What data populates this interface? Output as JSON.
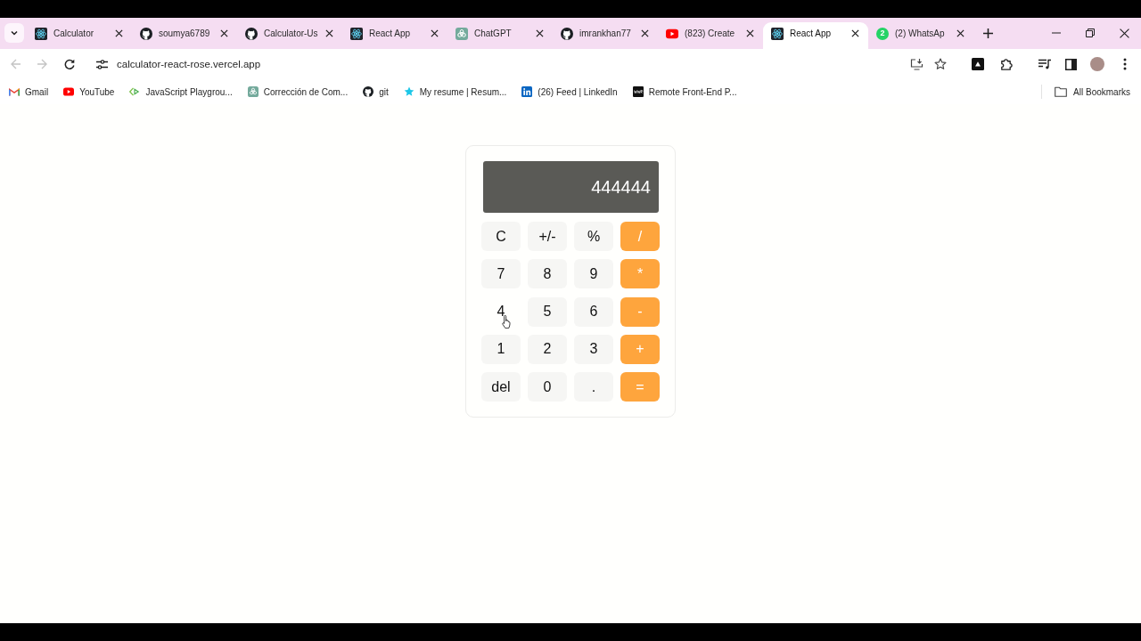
{
  "tabs_bar": {
    "tabs": [
      {
        "title": "Calculator",
        "kind": "react",
        "selected": false
      },
      {
        "title": "soumya6789",
        "kind": "github",
        "selected": false
      },
      {
        "title": "Calculator-Us",
        "kind": "github",
        "selected": false
      },
      {
        "title": "React App",
        "kind": "react",
        "selected": false
      },
      {
        "title": "ChatGPT",
        "kind": "chatgpt",
        "selected": false
      },
      {
        "title": "imrankhan77",
        "kind": "github",
        "selected": false
      },
      {
        "title": "(823) Create",
        "kind": "youtube",
        "selected": false
      },
      {
        "title": "React App",
        "kind": "react",
        "selected": true
      },
      {
        "title": "(2) WhatsAp",
        "kind": "whatsapp",
        "badge": "2",
        "selected": false
      }
    ]
  },
  "toolbar": {
    "back": {
      "disabled": true
    },
    "forward": {
      "disabled": true
    },
    "url": "calculator-react-rose.vercel.app"
  },
  "bookmarks_bar": {
    "items": [
      {
        "label": "Gmail",
        "kind": "gmail"
      },
      {
        "label": "YouTube",
        "kind": "youtube"
      },
      {
        "label": "JavaScript Playgrou...",
        "kind": "playground"
      },
      {
        "label": "Corrección de Com...",
        "kind": "chatgpt"
      },
      {
        "label": "git",
        "kind": "github"
      },
      {
        "label": "My resume | Resum...",
        "kind": "star"
      },
      {
        "label": "(26) Feed | LinkedIn",
        "kind": "linkedin"
      },
      {
        "label": "Remote Front-End P...",
        "kind": "wwr"
      }
    ],
    "all_bookmarks": "All Bookmarks"
  },
  "calculator": {
    "display": "444444",
    "keys": [
      {
        "label": "C",
        "kind": "function",
        "hovered": false
      },
      {
        "label": "+/-",
        "kind": "function",
        "hovered": false
      },
      {
        "label": "%",
        "kind": "function",
        "hovered": false
      },
      {
        "label": "/",
        "kind": "operator",
        "hovered": false
      },
      {
        "label": "7",
        "kind": "digit",
        "hovered": false
      },
      {
        "label": "8",
        "kind": "digit",
        "hovered": false
      },
      {
        "label": "9",
        "kind": "digit",
        "hovered": false
      },
      {
        "label": "*",
        "kind": "operator",
        "hovered": false
      },
      {
        "label": "4",
        "kind": "digit",
        "hovered": true
      },
      {
        "label": "5",
        "kind": "digit",
        "hovered": false
      },
      {
        "label": "6",
        "kind": "digit",
        "hovered": false
      },
      {
        "label": "-",
        "kind": "operator",
        "hovered": false
      },
      {
        "label": "1",
        "kind": "digit",
        "hovered": false
      },
      {
        "label": "2",
        "kind": "digit",
        "hovered": false
      },
      {
        "label": "3",
        "kind": "digit",
        "hovered": false
      },
      {
        "label": "+",
        "kind": "operator",
        "hovered": false
      },
      {
        "label": "del",
        "kind": "function",
        "hovered": false
      },
      {
        "label": "0",
        "kind": "digit",
        "hovered": false
      },
      {
        "label": ".",
        "kind": "digit",
        "hovered": false
      },
      {
        "label": "=",
        "kind": "operator",
        "hovered": false
      }
    ]
  }
}
